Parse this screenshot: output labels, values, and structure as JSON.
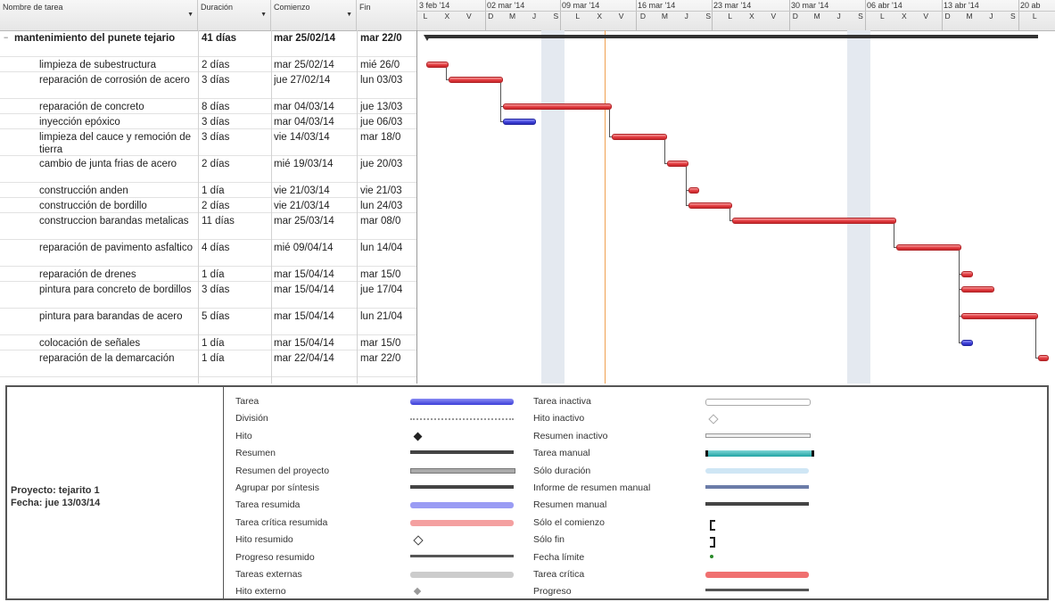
{
  "columns": {
    "name": "Nombre de tarea",
    "duration": "Duración",
    "start": "Comienzo",
    "finish": "Fin"
  },
  "timescale": {
    "weeks": [
      "3 feb '14",
      "02 mar '14",
      "09 mar '14",
      "16 mar '14",
      "23 mar '14",
      "30 mar '14",
      "06 abr '14",
      "13 abr '14",
      "20 ab"
    ],
    "days": [
      "L",
      "X",
      "V",
      "D",
      "M",
      "J",
      "S",
      "L",
      "X",
      "V",
      "D",
      "M",
      "J",
      "S",
      "L",
      "X",
      "V",
      "D",
      "M",
      "J",
      "S",
      "L",
      "X",
      "V",
      "D",
      "M",
      "J",
      "S",
      "L"
    ]
  },
  "tasks": [
    {
      "name": "mantenimiento del punete tejario",
      "duration": "41 días",
      "start": "mar 25/02/14",
      "finish": "mar 22/0",
      "summary": true
    },
    {
      "name": "limpieza de subestructura",
      "duration": "2 días",
      "start": "mar 25/02/14",
      "finish": "mié 26/0"
    },
    {
      "name": "reparación de corrosión de acero",
      "duration": "3 días",
      "start": "jue 27/02/14",
      "finish": "lun 03/03"
    },
    {
      "name": "reparación de concreto",
      "duration": "8 días",
      "start": "mar 04/03/14",
      "finish": "jue 13/03"
    },
    {
      "name": "inyección epóxico",
      "duration": "3 días",
      "start": "mar 04/03/14",
      "finish": "jue 06/03"
    },
    {
      "name": "limpieza del cauce y remoción de tierra",
      "duration": "3 días",
      "start": "vie 14/03/14",
      "finish": "mar 18/0"
    },
    {
      "name": "cambio de junta frias de acero",
      "duration": "2 días",
      "start": "mié 19/03/14",
      "finish": "jue 20/03"
    },
    {
      "name": "construcción anden",
      "duration": "1 día",
      "start": "vie 21/03/14",
      "finish": "vie 21/03"
    },
    {
      "name": "construcción de bordillo",
      "duration": "2 días",
      "start": "vie 21/03/14",
      "finish": "lun 24/03"
    },
    {
      "name": "construccion barandas metalicas",
      "duration": "11 días",
      "start": "mar 25/03/14",
      "finish": "mar 08/0"
    },
    {
      "name": "reparación de pavimento asfaltico",
      "duration": "4 días",
      "start": "mié 09/04/14",
      "finish": "lun 14/04"
    },
    {
      "name": "reparación de drenes",
      "duration": "1 día",
      "start": "mar 15/04/14",
      "finish": "mar 15/0"
    },
    {
      "name": "pintura para concreto de bordillos",
      "duration": "3 días",
      "start": "mar 15/04/14",
      "finish": "jue 17/04"
    },
    {
      "name": "pintura para barandas de acero",
      "duration": "5 días",
      "start": "mar 15/04/14",
      "finish": "lun 21/04"
    },
    {
      "name": "colocación de señales",
      "duration": "1 día",
      "start": "mar 15/04/14",
      "finish": "mar 15/0"
    },
    {
      "name": "reparación de la demarcación",
      "duration": "1 día",
      "start": "mar 22/04/14",
      "finish": "mar 22/0"
    }
  ],
  "legend": {
    "project": "Proyecto: tejarito 1",
    "date": "Fecha: jue 13/03/14",
    "left_items": [
      "Tarea",
      "División",
      "Hito",
      "Resumen",
      "Resumen del proyecto",
      "Agrupar por síntesis",
      "Tarea resumida",
      "Tarea crítica resumida",
      "Hito resumido",
      "Progreso resumido",
      "Tareas externas",
      "Hito externo"
    ],
    "right_items": [
      "Tarea inactiva",
      "Hito inactivo",
      "Resumen inactivo",
      "Tarea manual",
      "Sólo duración",
      "Informe de resumen manual",
      "Resumen manual",
      "Sólo el comienzo",
      "Sólo fin",
      "Fecha límite",
      "Tarea crítica",
      "Progreso"
    ]
  },
  "colors": {
    "critical": "#e0353a",
    "task": "#3b3ed8",
    "summary": "#333333",
    "status_line": "#f0a050",
    "weekend": "#e4e9f0"
  }
}
